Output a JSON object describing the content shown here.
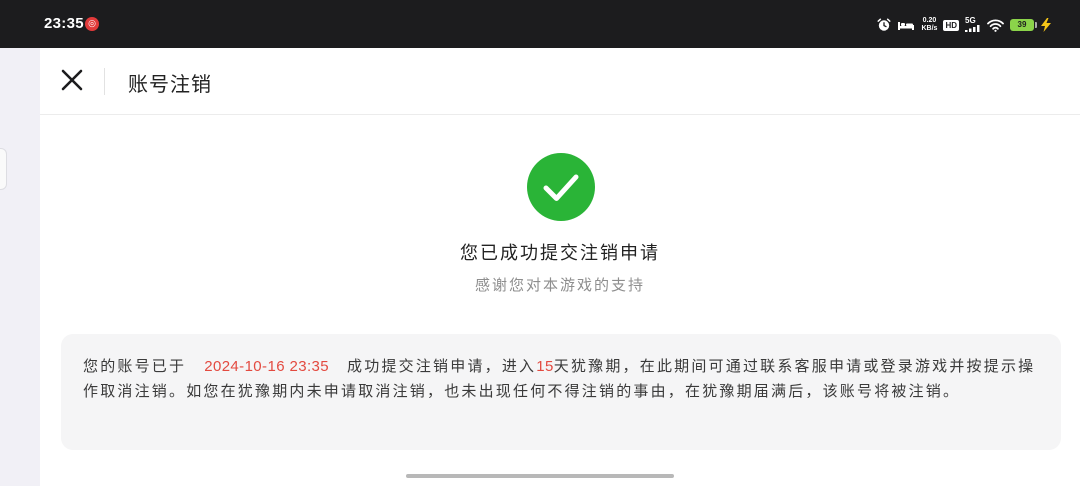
{
  "status_bar": {
    "time": "23:35",
    "netease_glyph": "◎",
    "net_speed_value": "0.20",
    "net_speed_unit": "KB/s",
    "hd_label": "HD",
    "network_label": "5G",
    "battery_level": "39",
    "icons": [
      "netease-music-icon",
      "alarm-icon",
      "sleep-bed-icon",
      "hd-voice-icon",
      "cellular-signal-icon",
      "wifi-icon",
      "battery-icon",
      "charging-bolt-icon"
    ]
  },
  "header": {
    "close_icon": "close-icon",
    "title": "账号注销"
  },
  "result": {
    "icon": "check-circle-icon",
    "title": "您已成功提交注销申请",
    "subtitle": "感谢您对本游戏的支持"
  },
  "notice": {
    "prefix": "您的账号已于",
    "datetime": "2024-10-16  23:35",
    "middle": "成功提交注销申请，进入",
    "days": "15",
    "rest": "天犹豫期，在此期间可通过联系客服申请或登录游戏并按提示操作取消注销。如您在犹豫期内未申请取消注销，也未出现任何不得注销的事由，在犹豫期届满后，该账号将被注销。"
  },
  "colors": {
    "success_green": "#2ab437",
    "highlight_red": "#e34a40",
    "status_bar_bg": "#1c1c1e",
    "battery_green": "#8bd34a",
    "charging_yellow": "#f5c518"
  }
}
